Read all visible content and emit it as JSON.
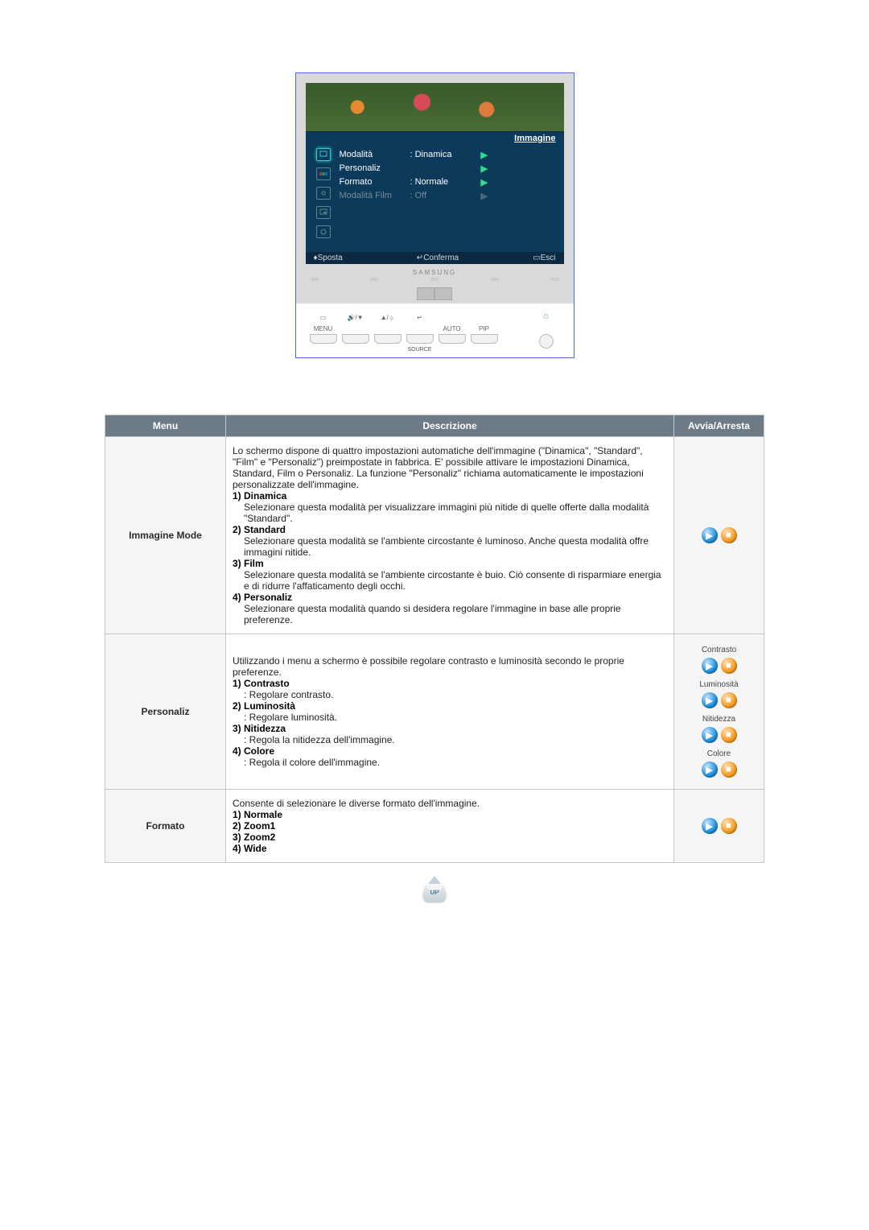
{
  "osd": {
    "title": "Immagine",
    "rows": [
      {
        "name": "Modalità",
        "value": ": Dinamica",
        "dim": false
      },
      {
        "name": "Personaliz",
        "value": "",
        "dim": false
      },
      {
        "name": "Formato",
        "value": ": Normale",
        "dim": false
      },
      {
        "name": "Modalità Film",
        "value": ": Off",
        "dim": true
      }
    ],
    "footer": {
      "move": "Sposta",
      "confirm": "Conferma",
      "exit": "Esci"
    },
    "brand": "SAMSUNG"
  },
  "buttons": {
    "menu": "MENU",
    "auto": "AUTO",
    "pip": "PIP",
    "source": "SOURCE"
  },
  "table": {
    "headers": {
      "menu": "Menu",
      "desc": "Descrizione",
      "play": "Avvia/Arresta"
    },
    "rows": [
      {
        "menu": "Immagine Mode",
        "intro": "Lo schermo dispone di quattro impostazioni automatiche dell'immagine (\"Dinamica\", \"Standard\", \"Film\" e \"Personaliz\") preimpostate in fabbrica. E' possibile attivare le impostazioni Dinamica, Standard, Film o Personaliz. La funzione \"Personaliz\" richiama automaticamente le impostazioni personalizzate dell'immagine.",
        "items": [
          {
            "title": "1) Dinamica",
            "body": "Selezionare questa modalità per visualizzare immagini più nitide di quelle offerte dalla modalità \"Standard\"."
          },
          {
            "title": "2) Standard",
            "body": "Selezionare questa modalità se l'ambiente circostante è luminoso. Anche questa modalità offre immagini nitide."
          },
          {
            "title": "3) Film",
            "body": "Selezionare questa modalità se l'ambiente circostante è buio. Ciò consente di risparmiare energia e di ridurre l'affaticamento degli occhi."
          },
          {
            "title": "4) Personaliz",
            "body": "Selezionare questa modalità quando si desidera regolare l'immagine in base alle proprie preferenze."
          }
        ],
        "actions": [
          {
            "label": ""
          }
        ]
      },
      {
        "menu": "Personaliz",
        "intro": "Utilizzando i menu a schermo è possibile regolare contrasto e luminosità secondo le proprie preferenze.",
        "items": [
          {
            "title": "1) Contrasto",
            "body": ": Regolare contrasto."
          },
          {
            "title": "2) Luminosità",
            "body": ": Regolare luminosità."
          },
          {
            "title": "3) Nitidezza",
            "body": ": Regola la nitidezza dell'immagine."
          },
          {
            "title": "4) Colore",
            "body": ": Regola il colore dell'immagine."
          }
        ],
        "actions": [
          {
            "label": "Contrasto"
          },
          {
            "label": "Luminosità"
          },
          {
            "label": "Nitidezza"
          },
          {
            "label": "Colore"
          }
        ]
      },
      {
        "menu": "Formato",
        "intro": "Consente di selezionare le diverse formato dell'immagine.",
        "items": [
          {
            "title": "1) Normale",
            "body": ""
          },
          {
            "title": "2) Zoom1",
            "body": ""
          },
          {
            "title": "3) Zoom2",
            "body": ""
          },
          {
            "title": "4) Wide",
            "body": ""
          }
        ],
        "actions": [
          {
            "label": ""
          }
        ]
      }
    ]
  },
  "up_label": "UP"
}
